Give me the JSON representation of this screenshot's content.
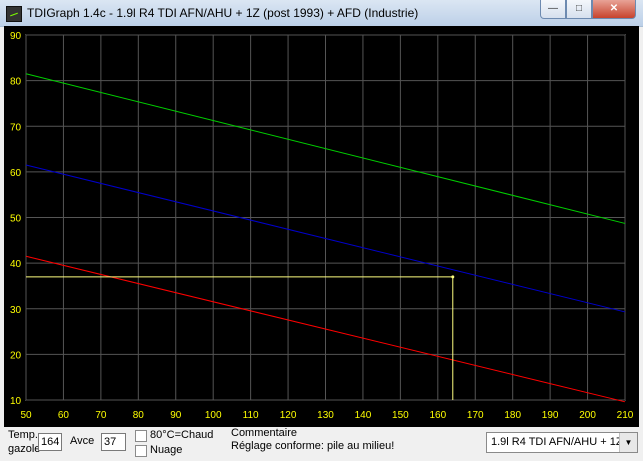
{
  "window": {
    "title": "TDIGraph 1.4c - 1.9l R4 TDI AFN/AHU + 1Z (post 1993) + AFD (Industrie)",
    "minimize_glyph": "—",
    "maximize_glyph": "□",
    "close_glyph": "✕"
  },
  "chart_data": {
    "type": "line",
    "xlim": [
      50,
      210
    ],
    "ylim": [
      10,
      90
    ],
    "x_ticks": [
      50,
      60,
      70,
      80,
      90,
      100,
      110,
      120,
      130,
      140,
      150,
      160,
      170,
      180,
      190,
      200,
      210
    ],
    "y_ticks": [
      10,
      20,
      30,
      40,
      50,
      60,
      70,
      80,
      90
    ],
    "grid": true,
    "series": [
      {
        "color": "#00d000",
        "x": [
          50,
          210
        ],
        "y": [
          81.5,
          48.7
        ]
      },
      {
        "color": "#0000cc",
        "x": [
          50,
          210
        ],
        "y": [
          61.5,
          29.3
        ]
      },
      {
        "color": "#ff0000",
        "x": [
          50,
          210
        ],
        "y": [
          41.5,
          9.6
        ]
      }
    ],
    "marker": {
      "x": 164,
      "y": 37,
      "color": "#ffff80"
    }
  },
  "controls": {
    "temp_label_line1": "Temp.",
    "temp_label_line2": "gazole",
    "temp_value": "164",
    "avce_label": "Avce",
    "avce_value": "37",
    "chaud_label": "80°C=Chaud",
    "nuage_label": "Nuage",
    "comment_label": "Commentaire",
    "comment_text": "Réglage conforme: pile au milieu!",
    "engine_select": "1.9l R4 TDI AFN/AHU + 1Z",
    "dropdown_arrow": "▼"
  }
}
